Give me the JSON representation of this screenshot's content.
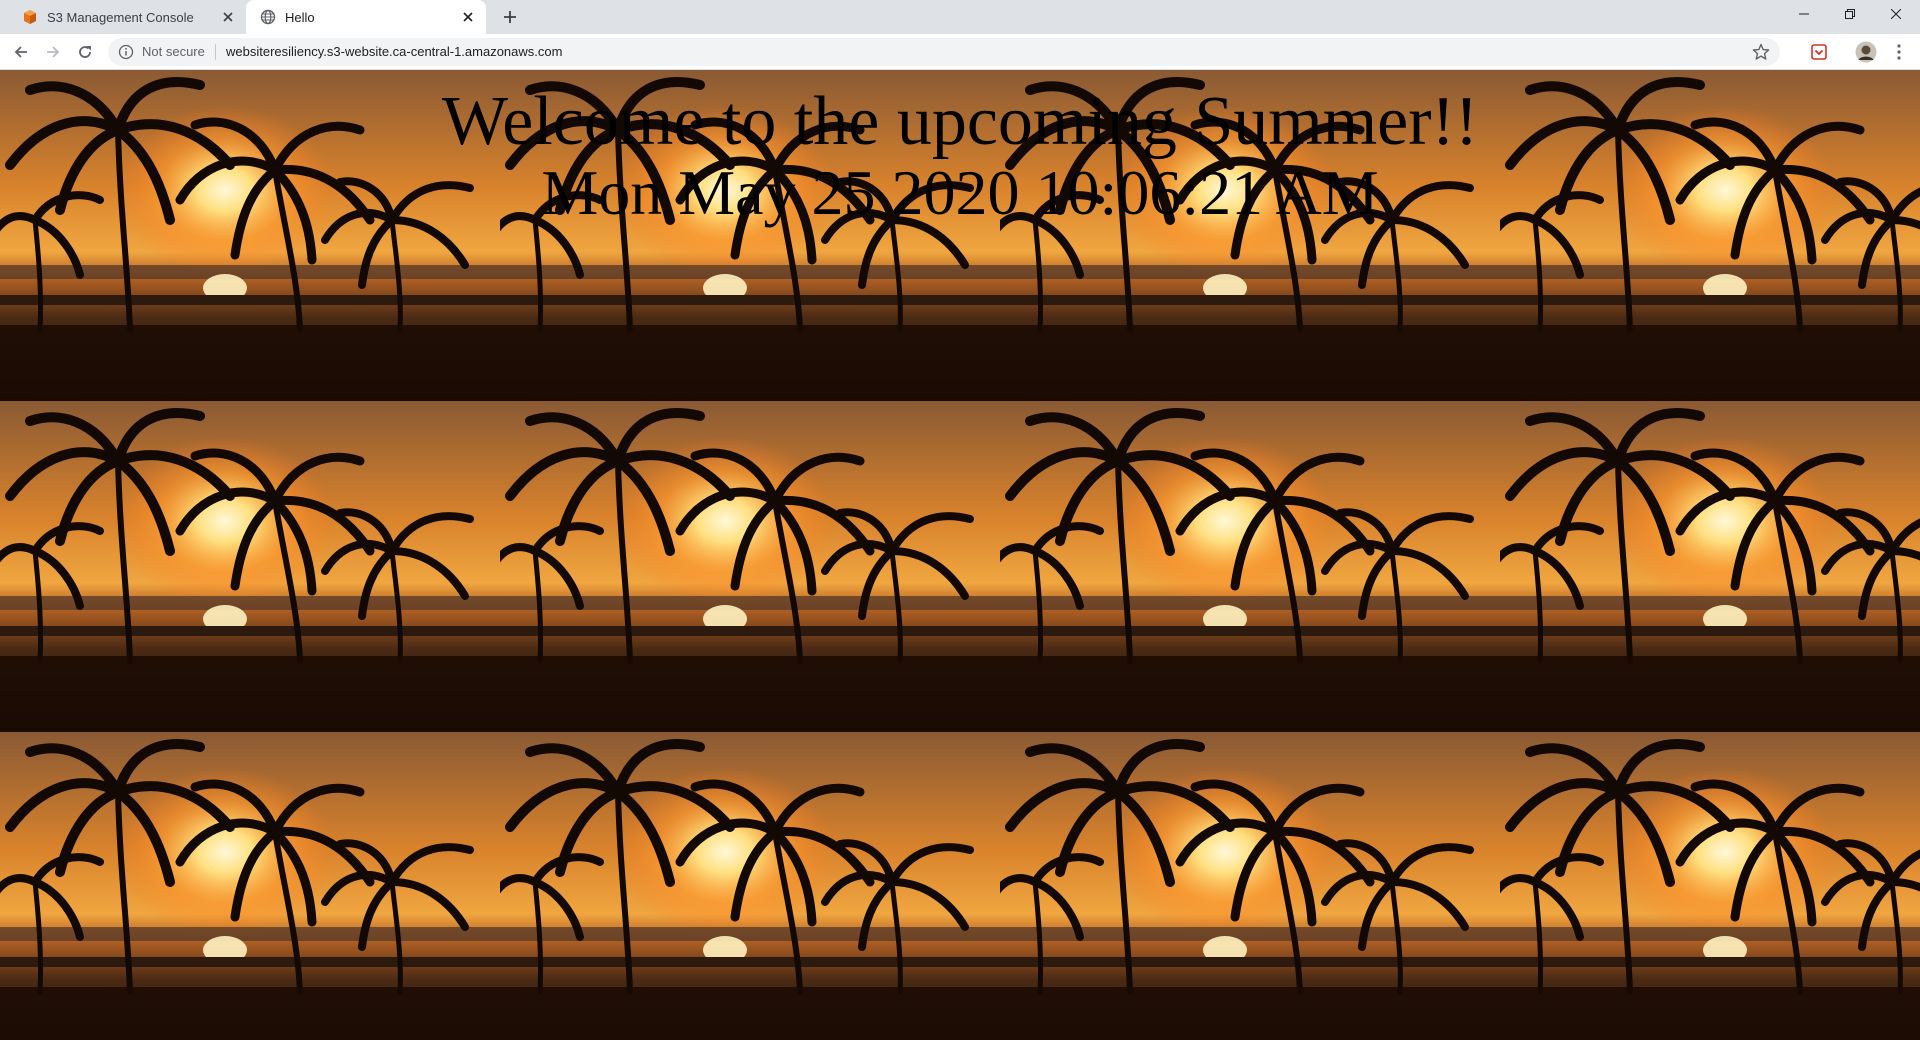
{
  "browser": {
    "tabs": [
      {
        "title": "S3 Management Console",
        "active": false,
        "favicon": "aws-s3-icon"
      },
      {
        "title": "Hello",
        "active": true,
        "favicon": "globe-icon"
      }
    ],
    "address_bar": {
      "security_label": "Not secure",
      "url": "websiteresiliency.s3-website.ca-central-1.amazonaws.com"
    }
  },
  "page": {
    "title": "Welcome to the upcoming Summer!!",
    "datetime": "Mon May 25 2020 10:06:21 AM",
    "background": "tiled palm-tree sunset photo"
  },
  "colors": {
    "sky_top": "#a6703a",
    "sun_glow": "#ffd24a",
    "sea": "#3a2414",
    "tab_strip": "#dee1e6",
    "s3_favicon": "#e8711a"
  }
}
